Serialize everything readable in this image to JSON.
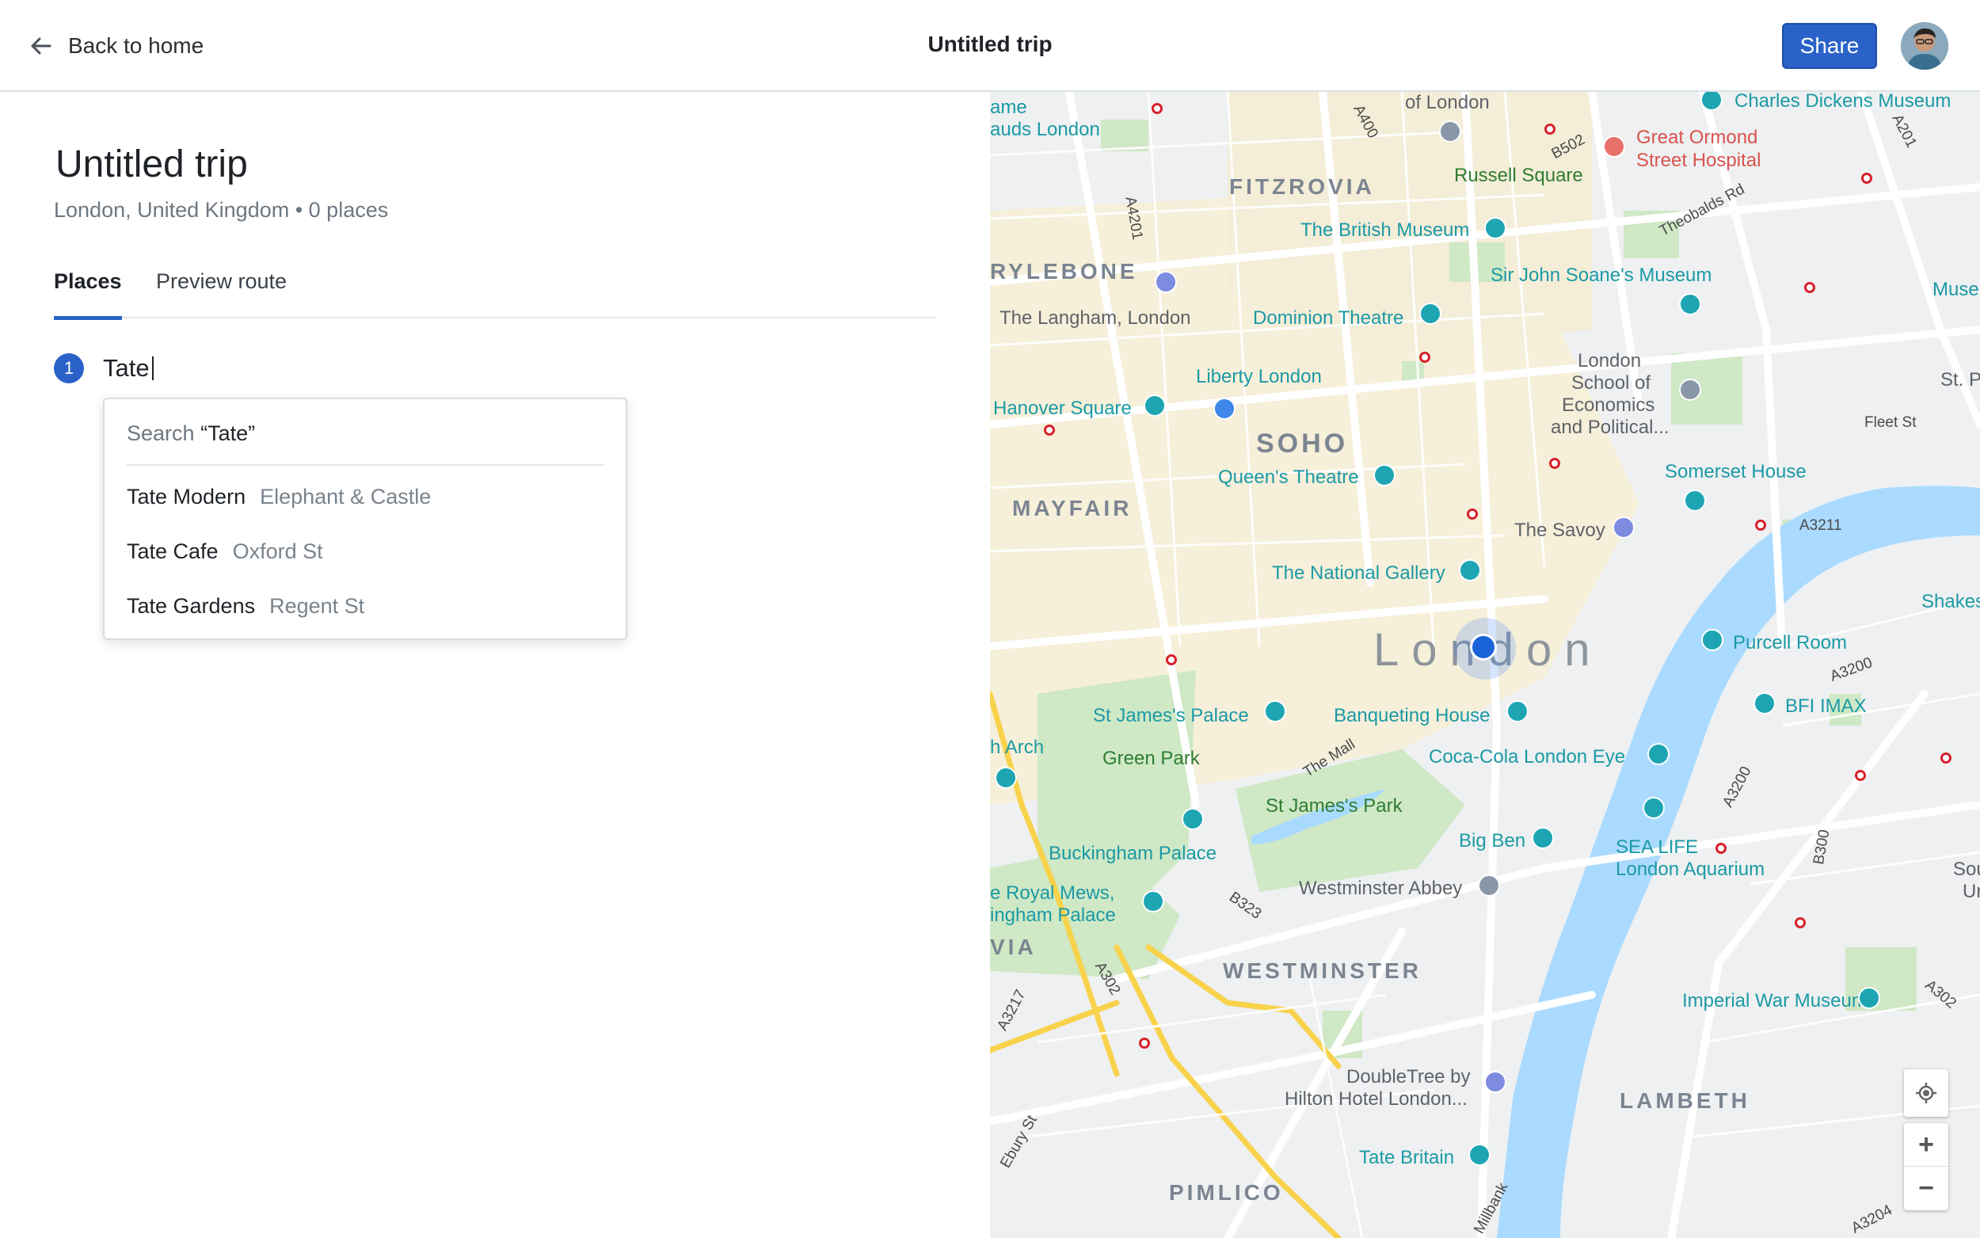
{
  "header": {
    "back_label": "Back to home",
    "title": "Untitled trip",
    "share_label": "Share"
  },
  "trip": {
    "title": "Untitled trip",
    "subtitle": "London, United Kingdom • 0 places",
    "tabs": [
      {
        "label": "Places",
        "active": true
      },
      {
        "label": "Preview route",
        "active": false
      }
    ],
    "places": [
      {
        "number": "1",
        "input_value": "Tate"
      }
    ]
  },
  "autocomplete": {
    "search_prefix": "Search",
    "search_query": "“Tate”",
    "results": [
      {
        "name": "Tate Modern",
        "location": "Elephant & Castle"
      },
      {
        "name": "Tate Cafe",
        "location": "Oxford St"
      },
      {
        "name": "Tate Gardens",
        "location": "Regent St"
      }
    ]
  },
  "map": {
    "city_label": "London",
    "areas": [
      "FITZROVIA",
      "RYLEBONE",
      "SOHO",
      "MAYFAIR",
      "WESTMINSTER",
      "LAMBETH",
      "PIMLICO",
      "VIA"
    ],
    "places": [
      "Charles Dickens Museum",
      "of London",
      "ame",
      "auds London",
      "Great Ormond",
      "Street Hospital",
      "Russell Square",
      "The British Museum",
      "Sir John Soane's Museum",
      "Museu",
      "The Langham, London",
      "Dominion Theatre",
      "London",
      "School of",
      "Economics",
      "and Political...",
      "St. P",
      "Liberty London",
      "Hanover Square",
      "Fleet St",
      "Queen's Theatre",
      "Somerset House",
      "The Savoy",
      "The National Gallery",
      "Shakespe",
      "Purcell Room",
      "BFI IMAX",
      "St James's Palace",
      "Banqueting House",
      "h Arch",
      "Green Park",
      "Coca-Cola London Eye",
      "St James's Park",
      "Big Ben",
      "SEA LIFE",
      "London Aquarium",
      "Sou",
      "Ur",
      "Buckingham Palace",
      "Westminster Abbey",
      "e Royal Mews,",
      "ingham Palace",
      "Imperial War Museum",
      "DoubleTree by",
      "Hilton Hotel London...",
      "Tate Britain"
    ],
    "roads": [
      "A400",
      "B502",
      "A201",
      "A4201",
      "Theobalds Rd",
      "A3211",
      "A3200",
      "The Mall",
      "B323",
      "A302",
      "A3217",
      "A3200",
      "B300",
      "A302",
      "Ebury St",
      "Millbank",
      "A3204"
    ],
    "zoom_in_label": "+",
    "zoom_out_label": "−"
  }
}
